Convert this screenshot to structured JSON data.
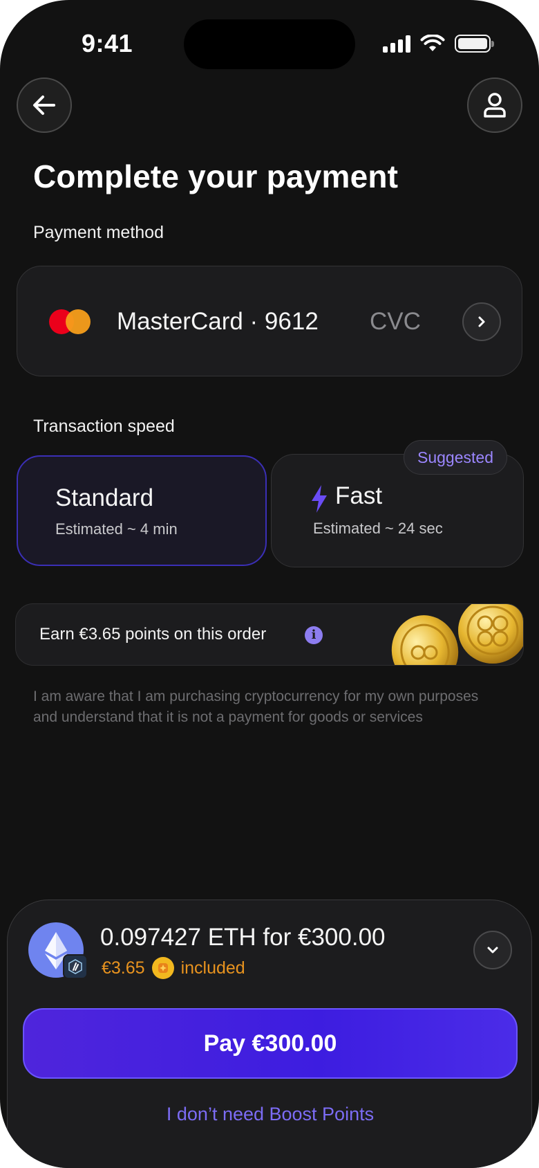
{
  "status": {
    "time": "9:41"
  },
  "header": {
    "back": "back",
    "profile": "profile"
  },
  "title": "Complete your payment",
  "payment_method": {
    "label": "Payment method",
    "card": "MasterCard · 9612",
    "cvc": "CVC"
  },
  "speed": {
    "label": "Transaction speed",
    "standard": {
      "title": "Standard",
      "sub": "Estimated ~ 4 min",
      "selected": true
    },
    "fast": {
      "title": "Fast",
      "sub": "Estimated ~ 24 sec",
      "badge": "Suggested"
    }
  },
  "earn": {
    "text": "Earn €3.65 points on this order"
  },
  "disclaimer": "I am aware that I am purchasing cryptocurrency for my own purposes and understand that it is not a payment for goods or services",
  "summary": {
    "amount": "0.097427 ETH for €300.00",
    "points": "€3.65",
    "included": "included",
    "pay_label": "Pay €300.00",
    "no_boost": "I don’t need Boost Points"
  },
  "colors": {
    "accent": "#4f25dc",
    "link": "#7c6cf5",
    "points": "#e8931f",
    "background": "#121212"
  },
  "icons": [
    "arrow-left-icon",
    "user-icon",
    "mastercard-logo",
    "chevron-right-icon",
    "lightning-icon",
    "info-icon",
    "coins-image",
    "ethereum-icon",
    "arbitrum-icon",
    "boost-coin-icon",
    "chevron-down-icon"
  ]
}
